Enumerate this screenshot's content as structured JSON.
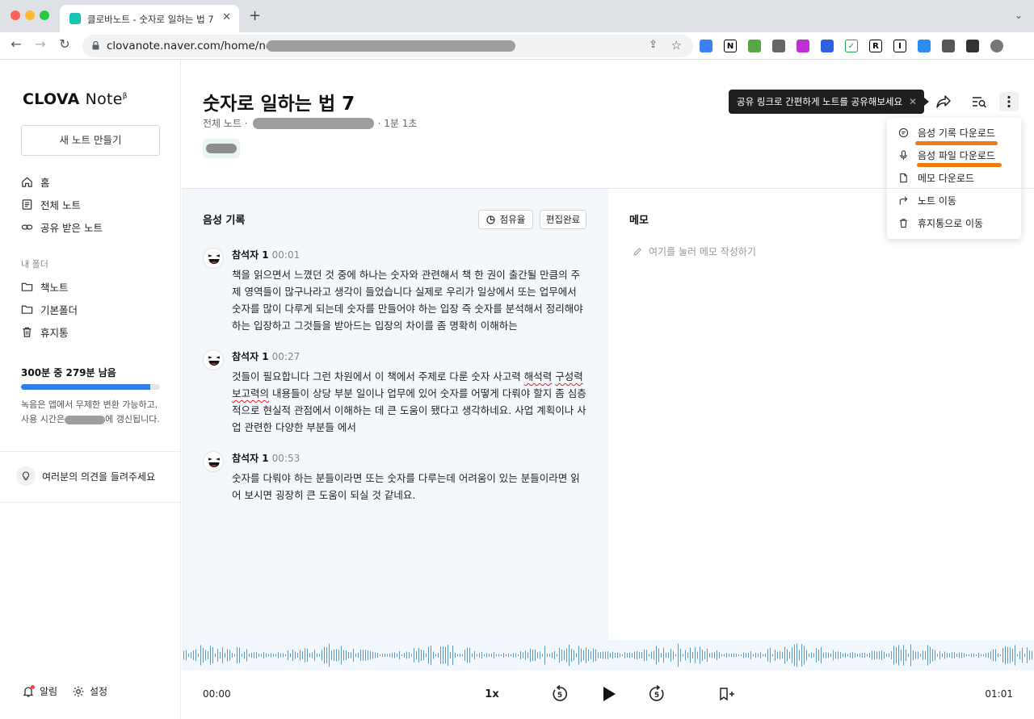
{
  "browser": {
    "tab_title": "클로바노트 - 숫자로 일하는 법 7",
    "tab_close": "✕",
    "new_tab": "+",
    "tab_menu": "⌄",
    "url": "clovanote.naver.com/home/note/",
    "extensions": [
      {
        "label": "",
        "color": "#3b82f6"
      },
      {
        "label": "N",
        "color": "#000000"
      },
      {
        "label": "",
        "color": "#56a845"
      },
      {
        "label": "",
        "color": "#666666"
      },
      {
        "label": "",
        "color": "#c02fd6"
      },
      {
        "label": "",
        "color": "#2a62e0"
      },
      {
        "label": "✓",
        "color": "#1aa34a"
      },
      {
        "label": "R",
        "color": "#000000"
      },
      {
        "label": "I",
        "color": "#000000"
      },
      {
        "label": "",
        "color": "#2a8ef0"
      },
      {
        "label": "",
        "color": "#555555"
      },
      {
        "label": "",
        "color": "#333333"
      },
      {
        "label": "",
        "color": "#777777"
      }
    ]
  },
  "sidebar": {
    "logo": "CLOVA",
    "logo_note": "Note",
    "logo_sup": "β",
    "new_note": "새 노트 만들기",
    "items": [
      {
        "label": "홈",
        "icon": "home-icon"
      },
      {
        "label": "전체 노트",
        "icon": "notes-icon"
      },
      {
        "label": "공유 받은 노트",
        "icon": "link-icon"
      }
    ],
    "folder_section": "내 폴더",
    "folders": [
      {
        "label": "책노트",
        "icon": "folder-icon"
      },
      {
        "label": "기본폴더",
        "icon": "folder-icon"
      },
      {
        "label": "휴지통",
        "icon": "trash-icon"
      }
    ],
    "quota_title": "300분 중 279분 남음",
    "quota_ratio": 0.93,
    "quota_desc_1": "녹음은 앱에서 무제한 변환 가능하고,",
    "quota_desc_2_pre": "사용 시간은",
    "quota_desc_2_post": "에 갱신됩니다.",
    "feedback": "여러분의 의견을 들려주세요",
    "alarm": "알림",
    "settings": "설정"
  },
  "note": {
    "title": "숫자로 일하는 법 7",
    "breadcrumb_prefix": "전체 노트 ·",
    "breadcrumb_suffix": "· 1분 1초",
    "tooltip": "공유 링크로 간편하게 노트를 공유해보세요",
    "tooltip_close": "✕"
  },
  "menu": {
    "items": [
      {
        "label": "음성 기록 다운로드",
        "icon": "transcript-icon"
      },
      {
        "label": "음성 파일 다운로드",
        "icon": "mic-icon"
      },
      {
        "label": "메모 다운로드",
        "icon": "file-icon"
      },
      {
        "label": "노트 이동",
        "icon": "move-icon"
      },
      {
        "label": "휴지통으로 이동",
        "icon": "trash-icon"
      }
    ],
    "highlight_color": "#f07a10"
  },
  "transcript": {
    "title": "음성 기록",
    "share_btn": "점유율",
    "edit_btn": "편집완료",
    "entries": [
      {
        "speaker": "참석자 1",
        "time": "00:01",
        "text": "책을 읽으면서 느꼈던 것 중에 하나는 숫자와 관련해서 책 한 권이 출간될 만큼의 주제 영역들이 많구나라고 생각이 들었습니다  실제로 우리가 일상에서 또는 업무에서 숫자를 많이 다루게 되는데 숫자를 만들어야 하는 입장 즉 숫자를 분석해서 정리해야 하는 입장하고 그것들을 받아드는 입장의 차이를 좀 명확히 이해하는"
      },
      {
        "speaker": "참석자 1",
        "time": "00:27",
        "text_a": "것들이 필요합니다 그런 차원에서 이 책에서 주제로 다룬 숫자 사고력 ",
        "text_b": "해석력",
        "text_c": " ",
        "text_d": "구성력",
        "text_e": " 보고력의",
        "text_f": " 내용들이 상당 부분 일이나 업무에 있어 숫자를 어떻게 다뤄야 할지 좀 심층적으로 현실적 관점에서 이해하는 데 큰 도움이 됐다고 생각하네요. 사업 계획이나 사업 관련한 다양한 부분들 에서"
      },
      {
        "speaker": "참석자 1",
        "time": "00:53",
        "text": "숫자를 다뤄야 하는 분들이라면 또는 숫자를 다루는데 어려움이 있는 분들이라면 읽어 보시면 굉장히 큰 도움이 되실 것 같네요."
      }
    ]
  },
  "memo": {
    "title": "메모",
    "placeholder": "여기를 눌러 메모 작성하기"
  },
  "player": {
    "current": "00:00",
    "total": "01:01",
    "speed": "1x",
    "skip_back": "5",
    "skip_fwd": "5"
  },
  "colors": {
    "accent": "#2f7fe6",
    "waveform": "#5a97c2",
    "transcript_bg": "#f4f8fd"
  }
}
